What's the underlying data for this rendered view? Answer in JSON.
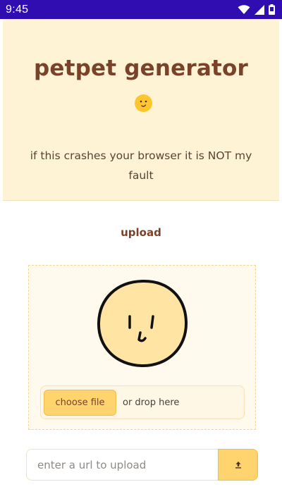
{
  "status_bar": {
    "time": "9:45",
    "icons": [
      "wifi-icon",
      "cellular-signal-icon",
      "battery-icon"
    ],
    "background": "#2f0db0"
  },
  "header": {
    "title": "petpet generator",
    "title_emoji": "smiling-face-emoji",
    "subtitle": "if this crashes your browser it is NOT my fault",
    "background": "#fff3d6",
    "title_color": "#7a4228"
  },
  "upload": {
    "section_title": "upload",
    "mascot": "round-face-illustration",
    "choose_file_label": "choose file",
    "drop_label": "or drop here",
    "accent": "#ffd36e"
  },
  "url_upload": {
    "placeholder": "enter a url to upload",
    "value": "",
    "button_icon": "upload-arrow-icon"
  }
}
